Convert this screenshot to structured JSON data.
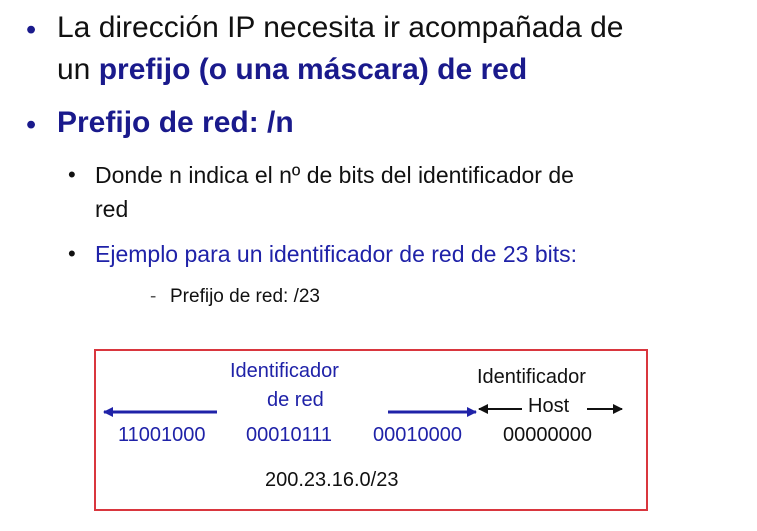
{
  "bullet_1": {
    "line_1": "La dirección IP necesita ir acompañada de",
    "line_2_plain": "un ",
    "line_2_bold": "prefijo (o una máscara) de red"
  },
  "bullet_2": {
    "text": "Prefijo de red: /n"
  },
  "sub_bullets": [
    {
      "line_1": "Donde n indica el nº de bits del identificador de",
      "line_2": "red"
    },
    {
      "text": "Ejemplo para un identificador de red de 23 bits:"
    }
  ],
  "sub_sub_bullet": {
    "dash": "-",
    "text": "Prefijo de red: /23"
  },
  "diagram": {
    "net_label_line_1": "Identificador",
    "net_label_line_2": "de red",
    "host_label_line_1": "Identificador",
    "host_label_line_2": "Host",
    "octets": [
      "11001000",
      "00010111",
      "00010000",
      "00000000"
    ],
    "result": "200.23.16.0/23",
    "colors": {
      "network": "#1f22a8",
      "host": "#111111",
      "border": "#d9363e"
    }
  }
}
